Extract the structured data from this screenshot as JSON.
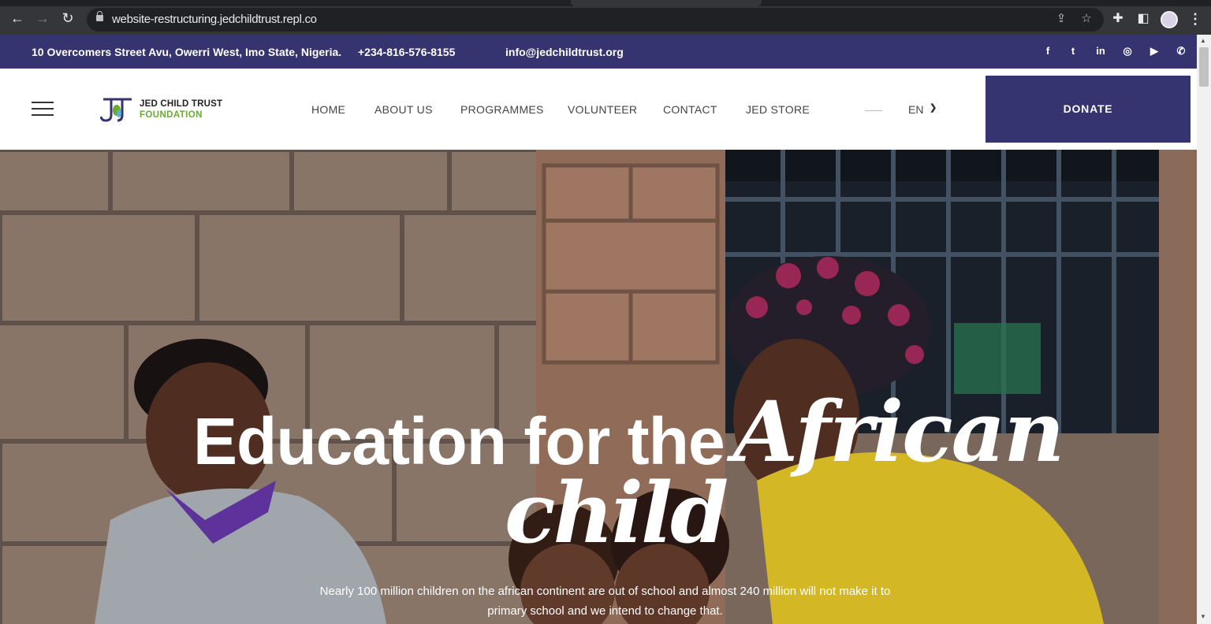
{
  "browser": {
    "url": "website-restructuring.jedchildtrust.repl.co",
    "icons": {
      "back": "back-arrow-icon",
      "forward": "forward-arrow-icon",
      "reload": "reload-icon",
      "share": "share-icon",
      "bookmark": "star-icon",
      "extensions": "puzzle-icon",
      "side_panel": "side-panel-icon",
      "menu": "kebab-menu-icon"
    }
  },
  "topbar": {
    "address": "10 Overcomers Street Avu, Owerri West, Imo State, Nigeria.",
    "phone": "+234-816-576-8155",
    "email": "info@jedchildtrust.org",
    "social": [
      {
        "name": "facebook-icon",
        "glyph": "f"
      },
      {
        "name": "twitter-icon",
        "glyph": "t"
      },
      {
        "name": "linkedin-icon",
        "glyph": "in"
      },
      {
        "name": "instagram-icon",
        "glyph": "◎"
      },
      {
        "name": "youtube-icon",
        "glyph": "▶"
      },
      {
        "name": "whatsapp-icon",
        "glyph": "✆"
      }
    ]
  },
  "header": {
    "logo_line1": "JED CHILD TRUST",
    "logo_line2": "FOUNDATION",
    "nav": [
      {
        "label": "HOME"
      },
      {
        "label": "ABOUT US"
      },
      {
        "label": "PROGRAMMES"
      },
      {
        "label": "VOLUNTEER"
      },
      {
        "label": "CONTACT"
      },
      {
        "label": "JED STORE"
      }
    ],
    "language": "EN",
    "donate_label": "DONATE"
  },
  "hero": {
    "title": "Education for the",
    "script_word1": "African",
    "script_word2": "child",
    "subtitle": "Nearly 100 million children on the african continent are out of school and almost 240 million will not make it to primary school and we intend to change that."
  },
  "colors": {
    "brand_navy": "#353370",
    "brand_green": "#6aaa2e"
  }
}
